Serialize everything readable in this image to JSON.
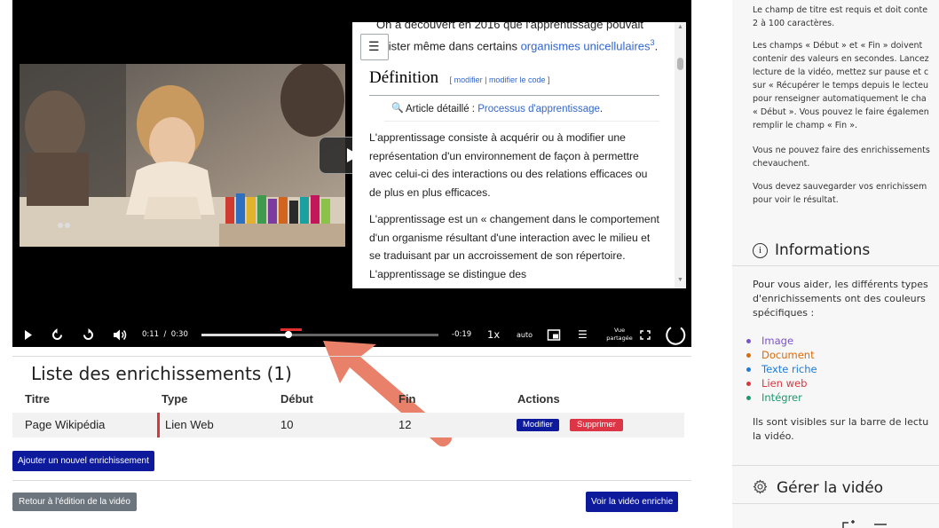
{
  "video": {
    "play_label": "Lire",
    "wiki": {
      "intro_line1": "On a découvert en 2016 que l'apprentissage pouvait",
      "intro_line2_prefix": "exister même dans certains ",
      "intro_link": "organismes unicellulaires",
      "intro_sup": "3",
      "intro_suffix": ".",
      "section_title": "Définition",
      "edit_link1": "modifier",
      "edit_sep": " | ",
      "edit_link2": "modifier le code",
      "detail_prefix": "Article détaillé : ",
      "detail_link": "Processus d'apprentissage",
      "detail_suffix": ".",
      "para1": "L'apprentissage consiste à acquérir ou à modifier une représentation d'un environnement de façon à permettre avec celui-ci des interactions ou des relations efficaces ou de plus en plus efficaces.",
      "para2": "L'apprentissage est un « changement dans le comportement d'un organisme résultant d'une interaction avec le milieu et se traduisant par un accroissement de son répertoire. L'apprentissage se distingue des"
    }
  },
  "controls": {
    "current_time": "0:11",
    "time_sep": "/",
    "duration": "0:30",
    "remaining": "-0:19",
    "speed": "1x",
    "quality": "auto",
    "shared_view_line1": "Vue",
    "shared_view_line2": "partagée",
    "progress": 0.367
  },
  "enrichments": {
    "heading": "Liste des enrichissements (1)",
    "columns": [
      "Titre",
      "Type",
      "Début",
      "Fin",
      "Actions"
    ],
    "rows": [
      {
        "title": "Page Wikipédia",
        "type": "Lien Web",
        "start": "10",
        "end": "12",
        "type_color": "#d9363e"
      }
    ],
    "edit_button": "Modifier",
    "delete_button": "Supprimer",
    "add_button": "Ajouter un nouvel enrichissement",
    "back_button": "Retour à l'édition de la vidéo",
    "view_button": "Voir la vidéo enrichie"
  },
  "sidebar": {
    "help": [
      [
        "Le champ de titre est requis et doit conte",
        "2 à 100 caractères."
      ],
      [
        "Les champs « Début » et « Fin » doivent",
        "contenir des valeurs en secondes. Lancez",
        "lecture de la vidéo, mettez sur pause et c",
        "sur « Récupérer le temps depuis le lecteu",
        "pour renseigner automatiquement le cha",
        "« Début ». Vous pouvez le faire égalemen",
        "remplir le champ « Fin »."
      ],
      [
        "Vous ne pouvez faire des enrichissements",
        "chevauchent."
      ],
      [
        "Vous devez sauvegarder vos enrichissem",
        "pour voir le résultat."
      ]
    ],
    "info_title": "Informations",
    "info_intro": [
      "Pour vous aider, les différents types",
      "d'enrichissements ont des couleurs",
      "spécifiques :"
    ],
    "legend": [
      {
        "label": "Image",
        "color": "#7b52c9"
      },
      {
        "label": "Document",
        "color": "#d86c0a"
      },
      {
        "label": "Texte riche",
        "color": "#1e7bd6"
      },
      {
        "label": "Lien web",
        "color": "#d9363e"
      },
      {
        "label": "Intégrer",
        "color": "#1a9a6c"
      }
    ],
    "info_outro": [
      "Ils sont visibles sur la barre de lectu",
      "la vidéo."
    ],
    "manage_title": "Gérer la vidéo"
  },
  "colors": {
    "primary": "#0d1a9c",
    "danger": "#dc3545",
    "secondary": "#6c757d",
    "link": "#3366cc",
    "arrow": "#e8806a",
    "progress_red": "#e03030"
  }
}
